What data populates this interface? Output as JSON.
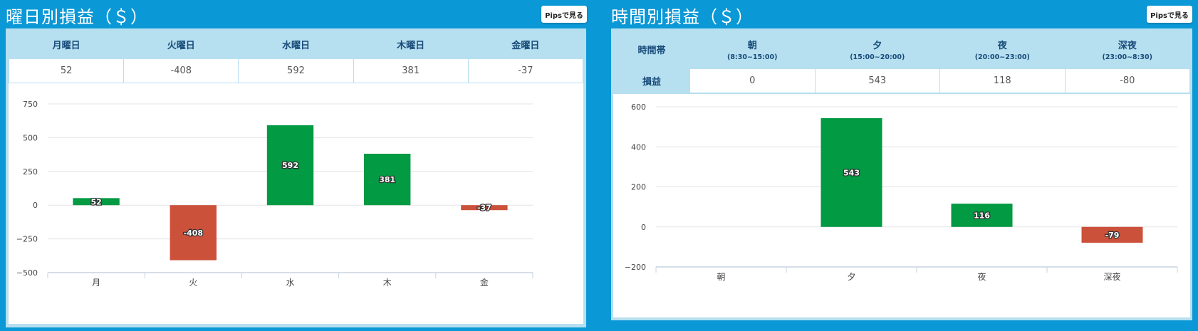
{
  "left": {
    "title": "曜日別損益（＄）",
    "pips_button": "Pipsで見る",
    "table": {
      "headers": [
        "月曜日",
        "火曜日",
        "水曜日",
        "木曜日",
        "金曜日"
      ],
      "values": [
        "52",
        "-408",
        "592",
        "381",
        "-37"
      ]
    }
  },
  "right": {
    "title": "時間別損益（＄）",
    "pips_button": "Pipsで見る",
    "table": {
      "corner": "時間帯",
      "row_label": "損益",
      "headers": [
        {
          "name": "朝",
          "range": "(8:30~15:00)"
        },
        {
          "name": "夕",
          "range": "(15:00~20:00)"
        },
        {
          "name": "夜",
          "range": "(20:00~23:00)"
        },
        {
          "name": "深夜",
          "range": "(23:00~8:30)"
        }
      ],
      "values": [
        "0",
        "543",
        "118",
        "-80"
      ]
    }
  },
  "colors": {
    "positive": "#029a43",
    "negative": "#cc513b",
    "background": "#0b98d6",
    "header": "#b6dff0",
    "header_text": "#174a78"
  },
  "chart_data": [
    {
      "type": "bar",
      "categories": [
        "月",
        "火",
        "水",
        "木",
        "金"
      ],
      "values": [
        52,
        -408,
        592,
        381,
        -37
      ],
      "data_labels": [
        "52",
        "-408",
        "592",
        "381",
        "-37"
      ],
      "yticks": [
        "750",
        "500",
        "250",
        "0",
        "−250",
        "−500"
      ],
      "ylim": [
        -500,
        750
      ],
      "grid": true,
      "title": "",
      "xlabel": "",
      "ylabel": ""
    },
    {
      "type": "bar",
      "categories": [
        "朝",
        "夕",
        "夜",
        "深夜"
      ],
      "values": [
        0,
        543,
        116,
        -79
      ],
      "data_labels": [
        "",
        "543",
        "116",
        "-79"
      ],
      "yticks": [
        "600",
        "400",
        "200",
        "0",
        "−200"
      ],
      "ylim": [
        -200,
        600
      ],
      "grid": true,
      "title": "",
      "xlabel": "",
      "ylabel": ""
    }
  ]
}
